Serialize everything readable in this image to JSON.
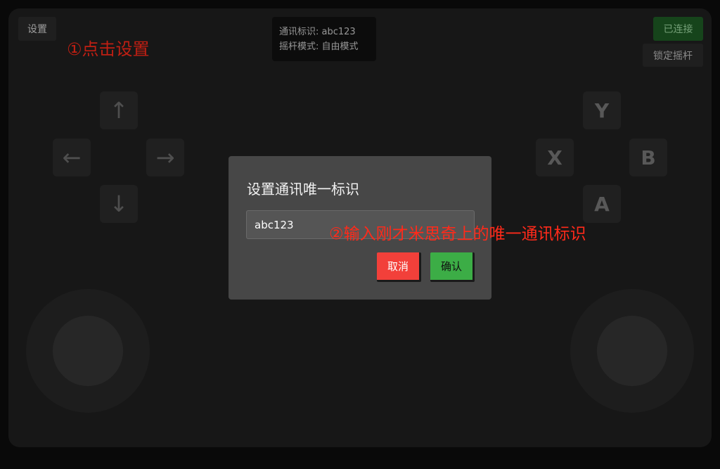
{
  "header": {
    "settings_label": "设置",
    "info_lines": [
      "通讯标识: abc123",
      "摇杆模式: 自由模式"
    ],
    "status_label": "已连接",
    "lock_label": "锁定摇杆"
  },
  "annotations": {
    "step1": "①点击设置",
    "step2": "②输入刚才米思奇上的唯一通讯标识"
  },
  "dpad": {
    "up": "↑",
    "down": "↓",
    "left": "←",
    "right": "→"
  },
  "face_buttons": {
    "y": "Y",
    "x": "X",
    "b": "B",
    "a": "A"
  },
  "dialog": {
    "title": "设置通讯唯一标识",
    "input_value": "abc123",
    "cancel_label": "取消",
    "confirm_label": "确认"
  },
  "colors": {
    "annotation": "#ff2a1a",
    "cancel": "#f2403a",
    "confirm": "#3cad46",
    "connected": "#1e5b25"
  }
}
